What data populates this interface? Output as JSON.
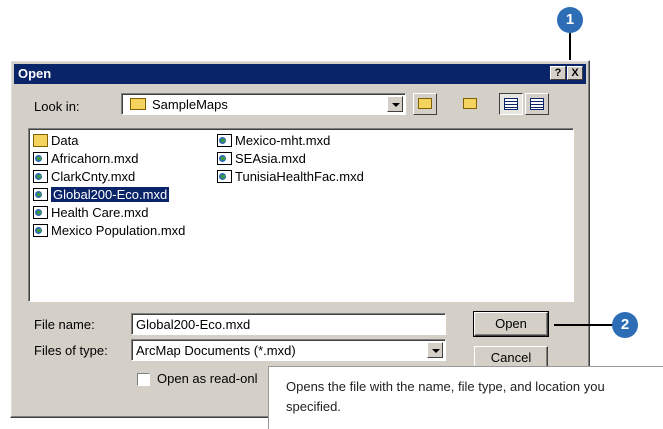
{
  "dialog": {
    "title": "Open",
    "help_btn": "?",
    "close_btn": "X"
  },
  "look_in": {
    "label": "Look in:",
    "value": "SampleMaps"
  },
  "files": [
    {
      "name": "Data",
      "type": "folder",
      "selected": false
    },
    {
      "name": "Africahorn.mxd",
      "type": "mxd",
      "selected": false
    },
    {
      "name": "ClarkCnty.mxd",
      "type": "mxd",
      "selected": false
    },
    {
      "name": "Global200-Eco.mxd",
      "type": "mxd",
      "selected": true
    },
    {
      "name": "Health Care.mxd",
      "type": "mxd",
      "selected": false
    },
    {
      "name": "Mexico Population.mxd",
      "type": "mxd",
      "selected": false
    },
    {
      "name": "Mexico-mht.mxd",
      "type": "mxd",
      "selected": false
    },
    {
      "name": "SEAsia.mxd",
      "type": "mxd",
      "selected": false
    },
    {
      "name": "TunisiaHealthFac.mxd",
      "type": "mxd",
      "selected": false
    }
  ],
  "file_name": {
    "label": "File name:",
    "value": "Global200-Eco.mxd"
  },
  "files_of_type": {
    "label": "Files of type:",
    "value": "ArcMap Documents (*.mxd)"
  },
  "buttons": {
    "open": "Open",
    "cancel": "Cancel"
  },
  "read_only": {
    "label": "Open as read-onl",
    "checked": false
  },
  "callouts": {
    "one": "1",
    "two": "2"
  },
  "tooltip": {
    "text": "Opens the file with the name, file type, and location you specified."
  },
  "colors": {
    "title_bar": "#0a246a",
    "callout": "#2d6db5",
    "dialog_face": "#d4d0c8"
  }
}
